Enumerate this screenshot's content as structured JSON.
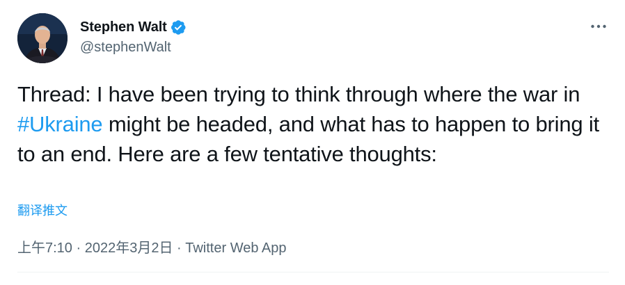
{
  "author": {
    "display_name": "Stephen Walt",
    "handle": "@stephenWalt",
    "verified": true,
    "avatar_icon": "profile-photo",
    "verified_icon": "verified-badge-icon"
  },
  "menu": {
    "more_icon": "more-options-icon"
  },
  "tweet": {
    "text_part1": "Thread: I have been trying to think through where the war in ",
    "hashtag": "#Ukraine",
    "text_part2": " might be headed, and what has to happen to bring it to an end.  Here are a few tentative thoughts:"
  },
  "translate_label": "翻译推文",
  "meta": {
    "time": "上午7:10",
    "separator1": " · ",
    "date": "2022年3月2日",
    "separator2": " · ",
    "source": "Twitter Web App"
  },
  "colors": {
    "accent": "#1d9bf0",
    "text": "#0f1419",
    "secondary": "#536471",
    "divider": "#eff3f4"
  }
}
